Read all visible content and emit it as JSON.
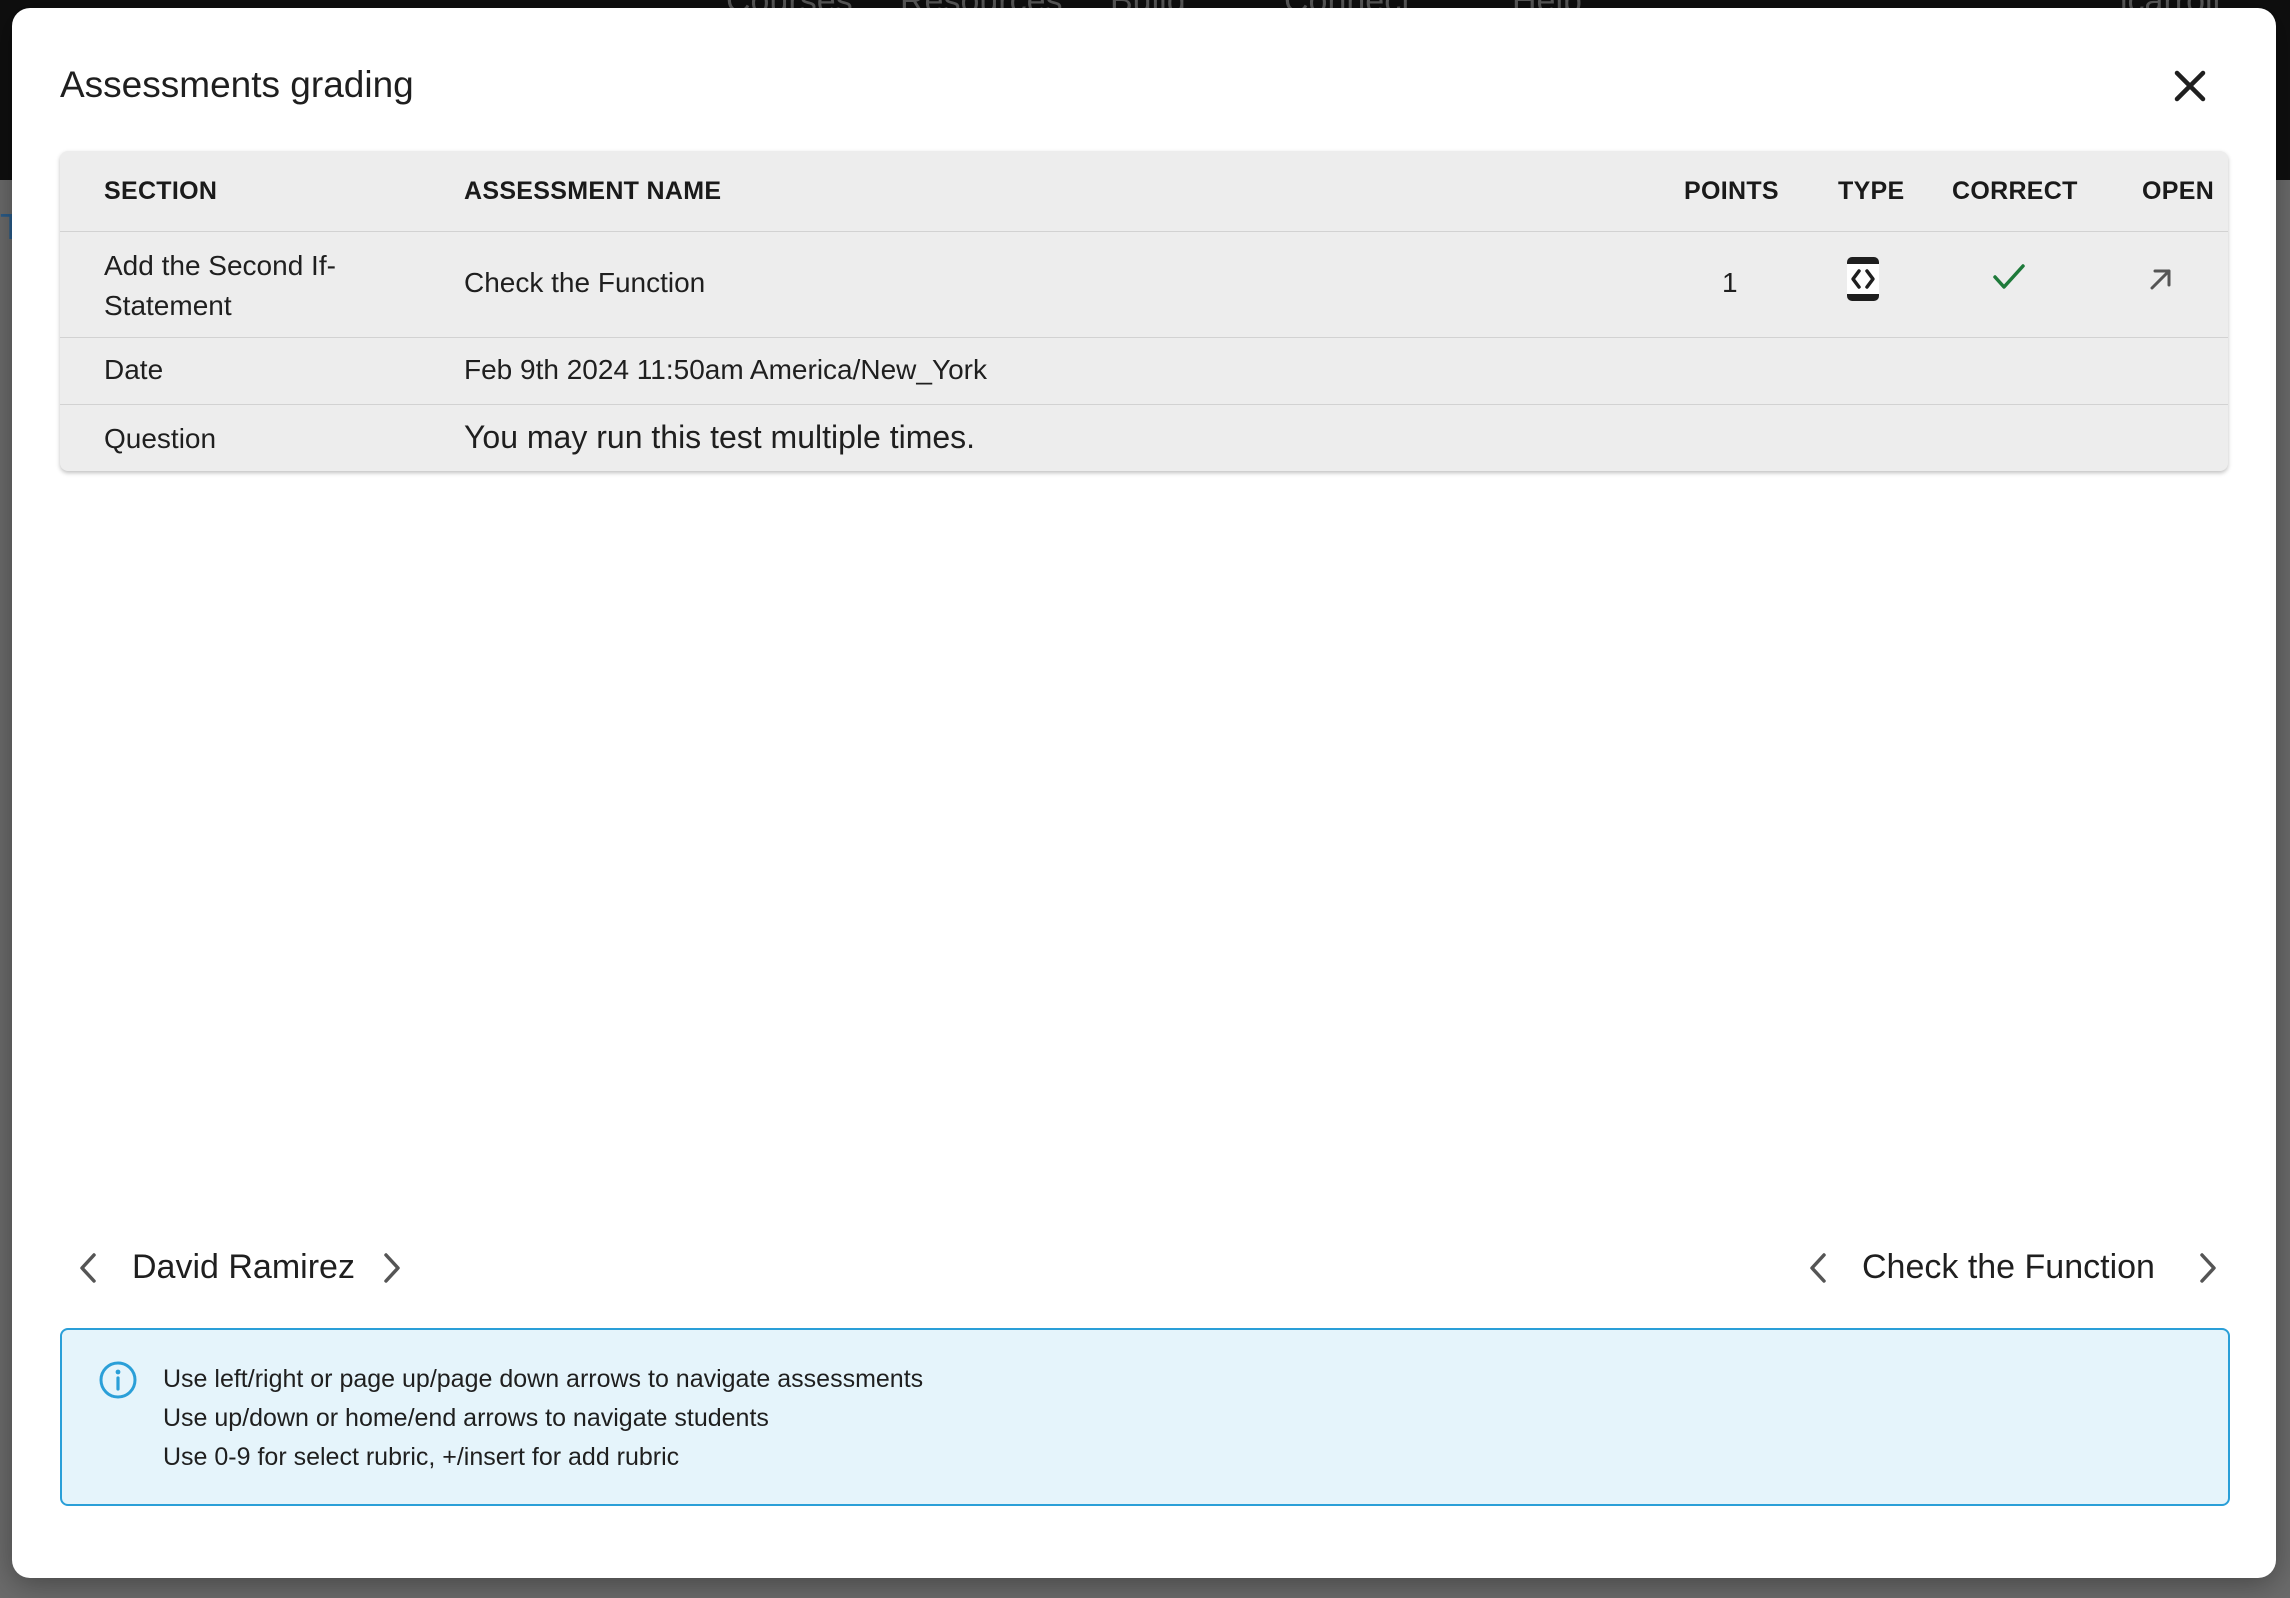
{
  "background": {
    "nav_items": [
      "Courses",
      "Resources",
      "Build",
      "Connect",
      "Help"
    ],
    "user": "lcarroll",
    "partial_link": "T"
  },
  "modal": {
    "title": "Assessments grading",
    "close_icon": "close-icon"
  },
  "table": {
    "headers": {
      "section": "SECTION",
      "assessment_name": "ASSESSMENT NAME",
      "points": "POINTS",
      "type": "TYPE",
      "correct": "CORRECT",
      "open": "OPEN"
    },
    "row": {
      "section_line1": "Add the Second If-",
      "section_line2": "Statement",
      "assessment_name": "Check the Function",
      "points": "1",
      "type_icon": "code-test-icon",
      "correct_icon": "checkmark-icon",
      "open_icon": "open-external-arrow-icon"
    },
    "date": {
      "label": "Date",
      "value": "Feb 9th 2024 11:50am America/New_York"
    },
    "question": {
      "label": "Question",
      "value": "You may run this test multiple times."
    }
  },
  "navigation": {
    "student": "David Ramirez",
    "assessment": "Check the Function"
  },
  "info": {
    "icon": "info-icon",
    "lines": [
      "Use left/right or page up/page down arrows to navigate assessments",
      "Use up/down or home/end arrows to navigate students",
      "Use 0-9 for select rubric, +/insert for add rubric"
    ]
  },
  "colors": {
    "accent_check": "#1e7a3a",
    "info_border": "#2a9fd8",
    "info_bg": "#e5f4fb"
  }
}
